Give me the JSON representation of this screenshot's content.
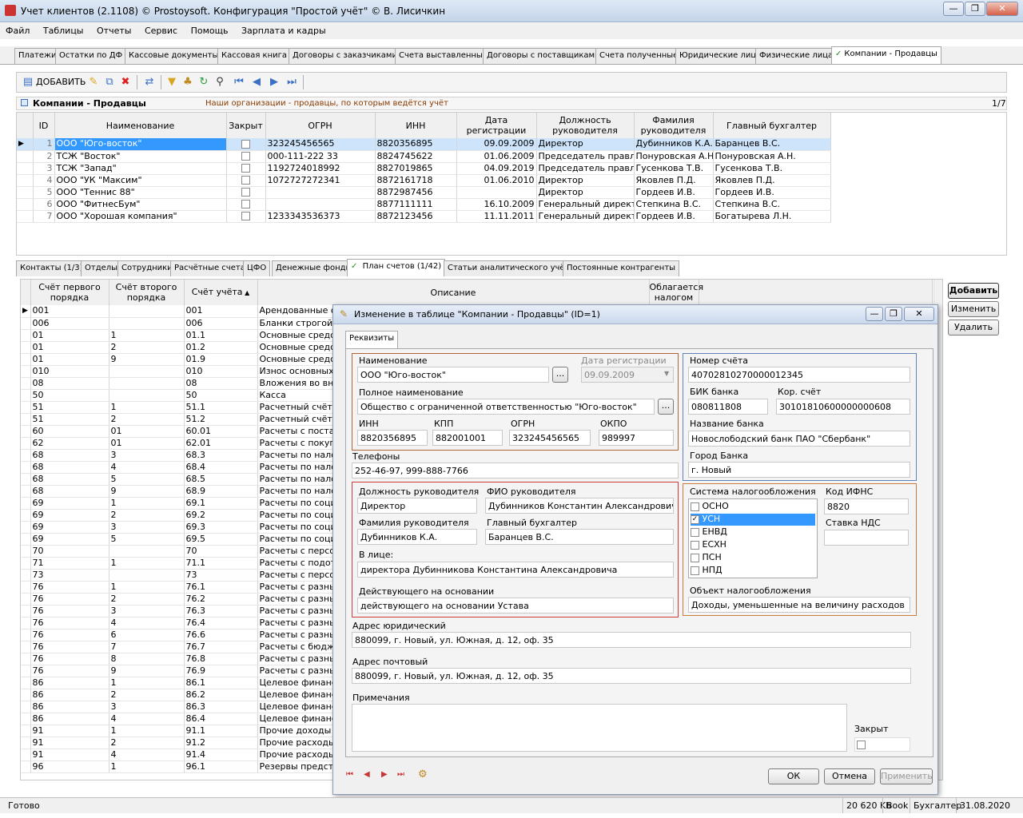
{
  "window": {
    "title": "Учет клиентов (2.1108) © Prostoysoft. Конфигурация \"Простой учёт\" © В. Лисичкин"
  },
  "menu": [
    "Файл",
    "Таблицы",
    "Отчеты",
    "Сервис",
    "Помощь",
    "Зарплата и кадры"
  ],
  "main_tabs": [
    "Платежи",
    "Остатки по ДФ",
    "Кассовые документы",
    "Кассовая книга",
    "Договоры с заказчиками",
    "Счета выставленные",
    "Договоры с поставщиками",
    "Счета полученные",
    "Юридические лица",
    "Физические лица",
    "Компании - Продавцы"
  ],
  "toolbar": {
    "add_label": "ДОБАВИТЬ"
  },
  "panel": {
    "title": "Компании - Продавцы",
    "description": "Наши организации - продавцы, по которым ведётся учёт",
    "counter": "1/7"
  },
  "companies": {
    "headers": [
      "ID",
      "Наименование",
      "Закрыт",
      "ОГРН",
      "ИНН",
      "Дата регистрации",
      "Должность руководителя",
      "Фамилия руководителя",
      "Главный бухгалтер"
    ],
    "rows": [
      [
        "1",
        "ООО \"Юго-восток\"",
        "323245456565",
        "8820356895",
        "09.09.2009",
        "Директор",
        "Дубинников К.А.",
        "Баранцев В.С."
      ],
      [
        "2",
        "ТСЖ \"Восток\"",
        "000-111-222 33",
        "8824745622",
        "01.06.2009",
        "Председатель правле",
        "Понуровская А.Н.",
        "Понуровская А.Н."
      ],
      [
        "3",
        "ТСЖ \"Запад\"",
        "1192724018992",
        "8827019865",
        "04.09.2019",
        "Председатель правле",
        "Гусенкова Т.В.",
        "Гусенкова Т.В."
      ],
      [
        "4",
        "ООО \"УК \"Максим\"",
        "1072727272341",
        "8872161718",
        "01.06.2010",
        "Директор",
        "Яковлев П.Д.",
        "Яковлев П.Д."
      ],
      [
        "5",
        "ООО \"Теннис 88\"",
        "",
        "8872987456",
        "",
        "Директор",
        "Гордеев И.В.",
        "Гордеев И.В."
      ],
      [
        "6",
        "ООО \"ФитнесБум\"",
        "",
        "8877111111",
        "16.10.2009",
        "Генеральный директо",
        "Степкина В.С.",
        "Степкина В.С."
      ],
      [
        "7",
        "ООО \"Хорошая компания\"",
        "1233343536373",
        "8872123456",
        "11.11.2011",
        "Генеральный директо",
        "Гордеев И.В.",
        "Богатырева Л.Н."
      ]
    ]
  },
  "sub_tabs": [
    "Контакты (1/3)",
    "Отделы",
    "Сотрудники",
    "Расчётные счета",
    "ЦФО",
    "Денежные фонды",
    "План счетов (1/42)",
    "Статьи аналитического учёта",
    "Постоянные контрагенты"
  ],
  "accounts": {
    "headers": [
      "Счёт первого порядка",
      "Счёт второго порядка",
      "Счёт учёта",
      "Описание",
      "Облагается налогом"
    ],
    "rows": [
      [
        "001",
        "",
        "001",
        "Арендованные о"
      ],
      [
        "006",
        "",
        "006",
        "Бланки строгой о"
      ],
      [
        "01",
        "1",
        "01.1",
        "Основные средст"
      ],
      [
        "01",
        "2",
        "01.2",
        "Основные средст"
      ],
      [
        "01",
        "9",
        "01.9",
        "Основные средст"
      ],
      [
        "010",
        "",
        "010",
        "Износ основных с"
      ],
      [
        "08",
        "",
        "08",
        "Вложения во вне"
      ],
      [
        "50",
        "",
        "50",
        "Касса"
      ],
      [
        "51",
        "1",
        "51.1",
        "Расчетный счёт в"
      ],
      [
        "51",
        "2",
        "51.2",
        "Расчетный счёт в"
      ],
      [
        "60",
        "01",
        "60.01",
        "Расчеты с постав"
      ],
      [
        "62",
        "01",
        "62.01",
        "Расчеты с покупа"
      ],
      [
        "68",
        "3",
        "68.3",
        "Расчеты по нало"
      ],
      [
        "68",
        "4",
        "68.4",
        "Расчеты по нало"
      ],
      [
        "68",
        "5",
        "68.5",
        "Расчеты по нало"
      ],
      [
        "68",
        "9",
        "68.9",
        "Расчеты по нало"
      ],
      [
        "69",
        "1",
        "69.1",
        "Расчеты по социа"
      ],
      [
        "69",
        "2",
        "69.2",
        "Расчеты по социа"
      ],
      [
        "69",
        "3",
        "69.3",
        "Расчеты по социа"
      ],
      [
        "69",
        "5",
        "69.5",
        "Расчеты по социа"
      ],
      [
        "70",
        "",
        "70",
        "Расчеты с персон"
      ],
      [
        "71",
        "1",
        "71.1",
        "Расчеты с подотч"
      ],
      [
        "73",
        "",
        "73",
        "Расчеты с персон"
      ],
      [
        "76",
        "1",
        "76.1",
        "Расчеты с разны"
      ],
      [
        "76",
        "2",
        "76.2",
        "Расчеты с разны"
      ],
      [
        "76",
        "3",
        "76.3",
        "Расчеты с разны"
      ],
      [
        "76",
        "4",
        "76.4",
        "Расчеты с разны"
      ],
      [
        "76",
        "6",
        "76.6",
        "Расчеты с разны"
      ],
      [
        "76",
        "7",
        "76.7",
        "Расчеты с бюдже"
      ],
      [
        "76",
        "8",
        "76.8",
        "Расчеты с разны"
      ],
      [
        "76",
        "9",
        "76.9",
        "Расчеты с разны"
      ],
      [
        "86",
        "1",
        "86.1",
        "Целевое финанс"
      ],
      [
        "86",
        "2",
        "86.2",
        "Целевое финанс"
      ],
      [
        "86",
        "3",
        "86.3",
        "Целевое финанс"
      ],
      [
        "86",
        "4",
        "86.4",
        "Целевое финанс"
      ],
      [
        "91",
        "1",
        "91.1",
        "Прочие доходы"
      ],
      [
        "91",
        "2",
        "91.2",
        "Прочие расходы"
      ],
      [
        "91",
        "4",
        "91.4",
        "Прочие расходы:"
      ],
      [
        "96",
        "1",
        "96.1",
        "Резервы предсто"
      ]
    ]
  },
  "side_buttons": {
    "add": "Добавить",
    "edit": "Изменить",
    "delete": "Удалить"
  },
  "dialog": {
    "title": "Изменение в таблице \"Компании - Продавцы\" (ID=1)",
    "tab": "Реквизиты",
    "name_label": "Наименование",
    "name": "ООО \"Юго-восток\"",
    "regdate_label": "Дата регистрации",
    "regdate": "09.09.2009",
    "fullname_label": "Полное наименование",
    "fullname": "Общество с ограниченной ответственностью \"Юго-восток\"",
    "inn_label": "ИНН",
    "inn": "8820356895",
    "kpp_label": "КПП",
    "kpp": "882001001",
    "ogrn_label": "ОГРН",
    "ogrn": "323245456565",
    "okpo_label": "ОКПО",
    "okpo": "989997",
    "phones_label": "Телефоны",
    "phones": "252-46-97, 999-888-7766",
    "position_label": "Должность руководителя",
    "position": "Директор",
    "director_fio_label": "ФИО руководителя",
    "director_fio": "Дубинников Константин Александрович",
    "director_surname_label": "Фамилия руководителя",
    "director_surname": "Дубинников К.А.",
    "accountant_label": "Главный бухгалтер",
    "accountant": "Баранцев В.С.",
    "in_person_label": "В лице:",
    "in_person": "директора Дубинникова Константина Александровича",
    "basis_label": "Действующего на основании",
    "basis": "действующего на основании Устава",
    "account_label": "Номер счёта",
    "account": "40702810270000012345",
    "bik_label": "БИК банка",
    "bik": "080811808",
    "corr_label": "Кор. счёт",
    "corr": "30101810600000000608",
    "bank_label": "Название банка",
    "bank": "Новослободский банк ПАО \"Сбербанк\"",
    "city_label": "Город Банка",
    "city": "г. Новый",
    "tax_system_label": "Система налогообложения",
    "tax_options": [
      "ОСНО",
      "УСН",
      "ЕНВД",
      "ЕСХН",
      "ПСН",
      "НПД"
    ],
    "ifns_label": "Код ИФНС",
    "ifns": "8820",
    "vat_label": "Ставка НДС",
    "vat": "",
    "tax_object_label": "Объект налогообложения",
    "tax_object": "Доходы, уменьшенные на величину расходов",
    "legal_address_label": "Адрес юридический",
    "legal_address": "880099, г. Новый, ул. Южная, д. 12, оф. 35",
    "postal_address_label": "Адрес почтовый",
    "postal_address": "880099, г. Новый, ул. Южная, д. 12, оф. 35",
    "notes_label": "Примечания",
    "notes": "",
    "closed_label": "Закрыт",
    "ok": "ОК",
    "cancel": "Отмена",
    "apply": "Применить"
  },
  "status": {
    "left": "Готово",
    "memory": "20 620 Kb",
    "book": "Book",
    "user": "Бухгалтер",
    "date": "31.08.2020"
  },
  "colors": {
    "selection": "#cde4fb",
    "group_brown": "#b0643c",
    "group_blue": "#5f82b8",
    "group_red": "#d23a3a",
    "group_orange": "#c87d3c",
    "desc_text": "#8a3a00"
  }
}
